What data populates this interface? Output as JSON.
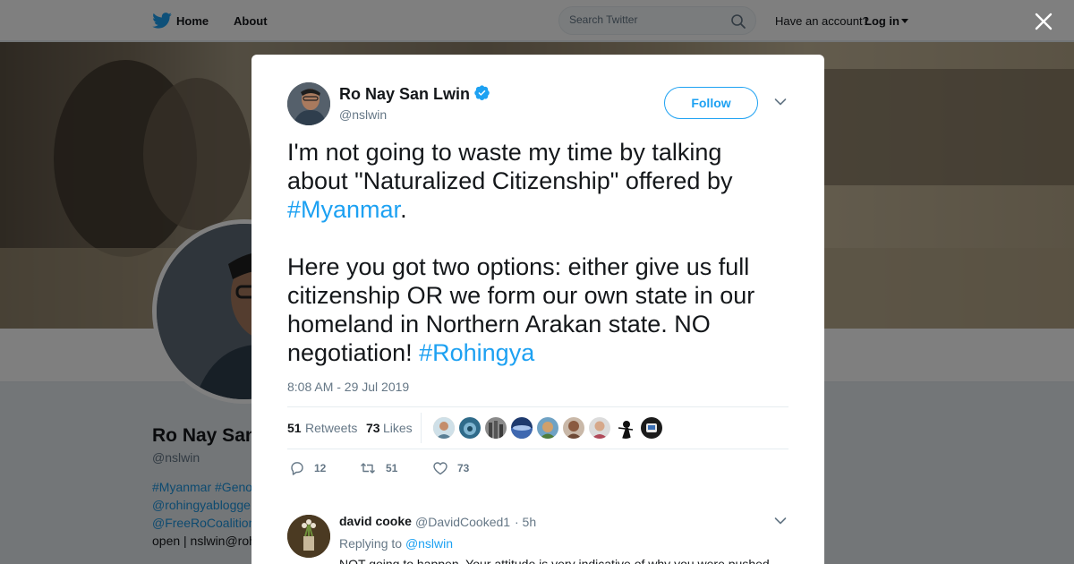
{
  "nav": {
    "home_label": "Home",
    "about_label": "About",
    "search_placeholder": "Search Twitter",
    "have_account": "Have an account?",
    "login_label": "Log in"
  },
  "profile": {
    "name": "Ro Nay San",
    "handle": "@nslwin",
    "bio_tags": "#Myanmar #Geno",
    "bio_line2": "@rohingyablogge",
    "bio_line3": "@FreeRoCoalition",
    "bio_line4": "open | nslwin@roh"
  },
  "tweet": {
    "author_name": "Ro Nay San Lwin",
    "author_handle": "@nslwin",
    "follow_label": "Follow",
    "text_part1": "I'm not going to waste my time by talking about \"Naturalized Citizenship\" offered by ",
    "hashtag1": "#Myanmar",
    "text_part1_end": ".",
    "text_part2": "Here you got two options: either give us full citizenship OR we form our own state in our homeland in Northern Arakan state. NO negotiation! ",
    "hashtag2": "#Rohingya",
    "timestamp": "8:08 AM - 29 Jul 2019",
    "retweets_count": "51",
    "retweets_label": "Retweets",
    "likes_count": "73",
    "likes_label": "Likes",
    "reply_action_count": "12",
    "retweet_action_count": "51",
    "like_action_count": "73"
  },
  "reply": {
    "name": "david cooke",
    "handle": "@DavidCooked1",
    "time": "· 5h",
    "replying_prefix": "Replying to ",
    "replying_to": "@nslwin",
    "text": "NOT going to happen. Your attitude is very indicative of why you were pushed"
  },
  "colors": {
    "accent": "#1da1f2",
    "text_primary": "#14171a",
    "text_secondary": "#657786"
  }
}
